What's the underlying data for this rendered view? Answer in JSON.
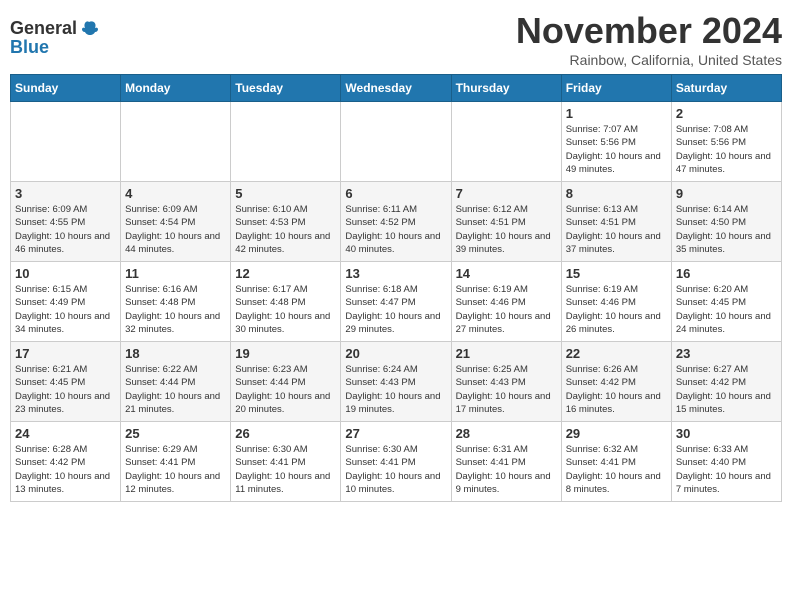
{
  "header": {
    "logo_general": "General",
    "logo_blue": "Blue",
    "title": "November 2024",
    "subtitle": "Rainbow, California, United States"
  },
  "days_of_week": [
    "Sunday",
    "Monday",
    "Tuesday",
    "Wednesday",
    "Thursday",
    "Friday",
    "Saturday"
  ],
  "weeks": [
    [
      {
        "day": "",
        "info": ""
      },
      {
        "day": "",
        "info": ""
      },
      {
        "day": "",
        "info": ""
      },
      {
        "day": "",
        "info": ""
      },
      {
        "day": "",
        "info": ""
      },
      {
        "day": "1",
        "info": "Sunrise: 7:07 AM\nSunset: 5:56 PM\nDaylight: 10 hours and 49 minutes."
      },
      {
        "day": "2",
        "info": "Sunrise: 7:08 AM\nSunset: 5:56 PM\nDaylight: 10 hours and 47 minutes."
      }
    ],
    [
      {
        "day": "3",
        "info": "Sunrise: 6:09 AM\nSunset: 4:55 PM\nDaylight: 10 hours and 46 minutes."
      },
      {
        "day": "4",
        "info": "Sunrise: 6:09 AM\nSunset: 4:54 PM\nDaylight: 10 hours and 44 minutes."
      },
      {
        "day": "5",
        "info": "Sunrise: 6:10 AM\nSunset: 4:53 PM\nDaylight: 10 hours and 42 minutes."
      },
      {
        "day": "6",
        "info": "Sunrise: 6:11 AM\nSunset: 4:52 PM\nDaylight: 10 hours and 40 minutes."
      },
      {
        "day": "7",
        "info": "Sunrise: 6:12 AM\nSunset: 4:51 PM\nDaylight: 10 hours and 39 minutes."
      },
      {
        "day": "8",
        "info": "Sunrise: 6:13 AM\nSunset: 4:51 PM\nDaylight: 10 hours and 37 minutes."
      },
      {
        "day": "9",
        "info": "Sunrise: 6:14 AM\nSunset: 4:50 PM\nDaylight: 10 hours and 35 minutes."
      }
    ],
    [
      {
        "day": "10",
        "info": "Sunrise: 6:15 AM\nSunset: 4:49 PM\nDaylight: 10 hours and 34 minutes."
      },
      {
        "day": "11",
        "info": "Sunrise: 6:16 AM\nSunset: 4:48 PM\nDaylight: 10 hours and 32 minutes."
      },
      {
        "day": "12",
        "info": "Sunrise: 6:17 AM\nSunset: 4:48 PM\nDaylight: 10 hours and 30 minutes."
      },
      {
        "day": "13",
        "info": "Sunrise: 6:18 AM\nSunset: 4:47 PM\nDaylight: 10 hours and 29 minutes."
      },
      {
        "day": "14",
        "info": "Sunrise: 6:19 AM\nSunset: 4:46 PM\nDaylight: 10 hours and 27 minutes."
      },
      {
        "day": "15",
        "info": "Sunrise: 6:19 AM\nSunset: 4:46 PM\nDaylight: 10 hours and 26 minutes."
      },
      {
        "day": "16",
        "info": "Sunrise: 6:20 AM\nSunset: 4:45 PM\nDaylight: 10 hours and 24 minutes."
      }
    ],
    [
      {
        "day": "17",
        "info": "Sunrise: 6:21 AM\nSunset: 4:45 PM\nDaylight: 10 hours and 23 minutes."
      },
      {
        "day": "18",
        "info": "Sunrise: 6:22 AM\nSunset: 4:44 PM\nDaylight: 10 hours and 21 minutes."
      },
      {
        "day": "19",
        "info": "Sunrise: 6:23 AM\nSunset: 4:44 PM\nDaylight: 10 hours and 20 minutes."
      },
      {
        "day": "20",
        "info": "Sunrise: 6:24 AM\nSunset: 4:43 PM\nDaylight: 10 hours and 19 minutes."
      },
      {
        "day": "21",
        "info": "Sunrise: 6:25 AM\nSunset: 4:43 PM\nDaylight: 10 hours and 17 minutes."
      },
      {
        "day": "22",
        "info": "Sunrise: 6:26 AM\nSunset: 4:42 PM\nDaylight: 10 hours and 16 minutes."
      },
      {
        "day": "23",
        "info": "Sunrise: 6:27 AM\nSunset: 4:42 PM\nDaylight: 10 hours and 15 minutes."
      }
    ],
    [
      {
        "day": "24",
        "info": "Sunrise: 6:28 AM\nSunset: 4:42 PM\nDaylight: 10 hours and 13 minutes."
      },
      {
        "day": "25",
        "info": "Sunrise: 6:29 AM\nSunset: 4:41 PM\nDaylight: 10 hours and 12 minutes."
      },
      {
        "day": "26",
        "info": "Sunrise: 6:30 AM\nSunset: 4:41 PM\nDaylight: 10 hours and 11 minutes."
      },
      {
        "day": "27",
        "info": "Sunrise: 6:30 AM\nSunset: 4:41 PM\nDaylight: 10 hours and 10 minutes."
      },
      {
        "day": "28",
        "info": "Sunrise: 6:31 AM\nSunset: 4:41 PM\nDaylight: 10 hours and 9 minutes."
      },
      {
        "day": "29",
        "info": "Sunrise: 6:32 AM\nSunset: 4:41 PM\nDaylight: 10 hours and 8 minutes."
      },
      {
        "day": "30",
        "info": "Sunrise: 6:33 AM\nSunset: 4:40 PM\nDaylight: 10 hours and 7 minutes."
      }
    ]
  ]
}
